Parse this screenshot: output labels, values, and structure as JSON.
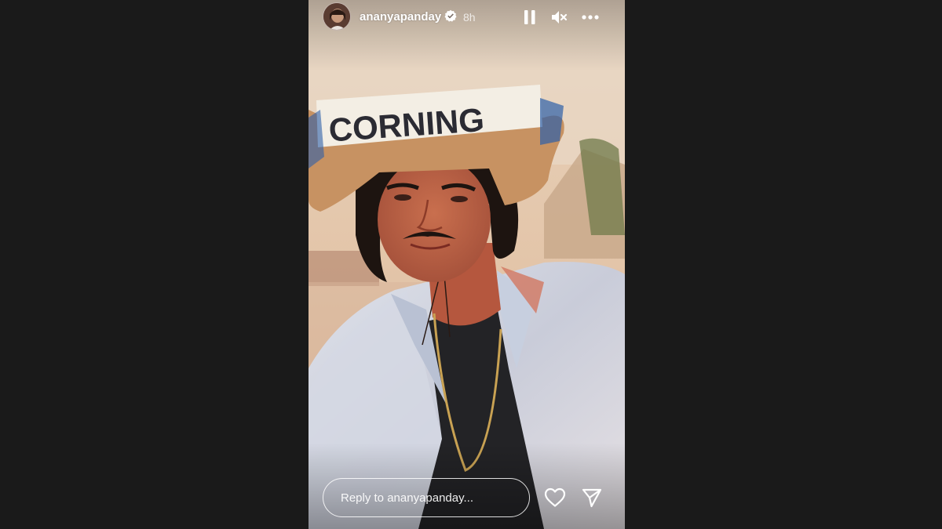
{
  "story": {
    "username": "ananyapanday",
    "time_ago": "8h",
    "photo_text": "CORNING"
  },
  "controls": {
    "icons": [
      "pause-icon",
      "mute-icon",
      "more-icon"
    ]
  },
  "reply": {
    "placeholder": "Reply to ananyapanday..."
  },
  "actions": {
    "icons": [
      "heart-icon",
      "send-icon"
    ]
  },
  "colors": {
    "background": "#1a1a1a",
    "verified_badge": "#ffffff",
    "text": "#ffffff"
  }
}
